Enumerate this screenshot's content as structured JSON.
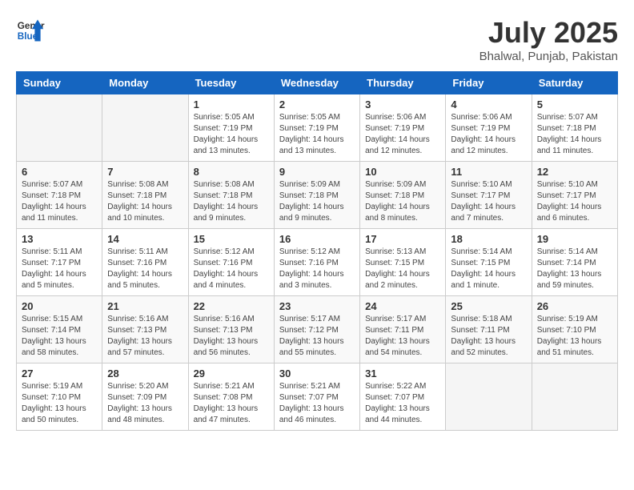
{
  "header": {
    "logo_general": "General",
    "logo_blue": "Blue",
    "month_title": "July 2025",
    "location": "Bhalwal, Punjab, Pakistan"
  },
  "calendar": {
    "days_of_week": [
      "Sunday",
      "Monday",
      "Tuesday",
      "Wednesday",
      "Thursday",
      "Friday",
      "Saturday"
    ],
    "weeks": [
      [
        {
          "day": "",
          "info": ""
        },
        {
          "day": "",
          "info": ""
        },
        {
          "day": "1",
          "info": "Sunrise: 5:05 AM\nSunset: 7:19 PM\nDaylight: 14 hours\nand 13 minutes."
        },
        {
          "day": "2",
          "info": "Sunrise: 5:05 AM\nSunset: 7:19 PM\nDaylight: 14 hours\nand 13 minutes."
        },
        {
          "day": "3",
          "info": "Sunrise: 5:06 AM\nSunset: 7:19 PM\nDaylight: 14 hours\nand 12 minutes."
        },
        {
          "day": "4",
          "info": "Sunrise: 5:06 AM\nSunset: 7:19 PM\nDaylight: 14 hours\nand 12 minutes."
        },
        {
          "day": "5",
          "info": "Sunrise: 5:07 AM\nSunset: 7:18 PM\nDaylight: 14 hours\nand 11 minutes."
        }
      ],
      [
        {
          "day": "6",
          "info": "Sunrise: 5:07 AM\nSunset: 7:18 PM\nDaylight: 14 hours\nand 11 minutes."
        },
        {
          "day": "7",
          "info": "Sunrise: 5:08 AM\nSunset: 7:18 PM\nDaylight: 14 hours\nand 10 minutes."
        },
        {
          "day": "8",
          "info": "Sunrise: 5:08 AM\nSunset: 7:18 PM\nDaylight: 14 hours\nand 9 minutes."
        },
        {
          "day": "9",
          "info": "Sunrise: 5:09 AM\nSunset: 7:18 PM\nDaylight: 14 hours\nand 9 minutes."
        },
        {
          "day": "10",
          "info": "Sunrise: 5:09 AM\nSunset: 7:18 PM\nDaylight: 14 hours\nand 8 minutes."
        },
        {
          "day": "11",
          "info": "Sunrise: 5:10 AM\nSunset: 7:17 PM\nDaylight: 14 hours\nand 7 minutes."
        },
        {
          "day": "12",
          "info": "Sunrise: 5:10 AM\nSunset: 7:17 PM\nDaylight: 14 hours\nand 6 minutes."
        }
      ],
      [
        {
          "day": "13",
          "info": "Sunrise: 5:11 AM\nSunset: 7:17 PM\nDaylight: 14 hours\nand 5 minutes."
        },
        {
          "day": "14",
          "info": "Sunrise: 5:11 AM\nSunset: 7:16 PM\nDaylight: 14 hours\nand 5 minutes."
        },
        {
          "day": "15",
          "info": "Sunrise: 5:12 AM\nSunset: 7:16 PM\nDaylight: 14 hours\nand 4 minutes."
        },
        {
          "day": "16",
          "info": "Sunrise: 5:12 AM\nSunset: 7:16 PM\nDaylight: 14 hours\nand 3 minutes."
        },
        {
          "day": "17",
          "info": "Sunrise: 5:13 AM\nSunset: 7:15 PM\nDaylight: 14 hours\nand 2 minutes."
        },
        {
          "day": "18",
          "info": "Sunrise: 5:14 AM\nSunset: 7:15 PM\nDaylight: 14 hours\nand 1 minute."
        },
        {
          "day": "19",
          "info": "Sunrise: 5:14 AM\nSunset: 7:14 PM\nDaylight: 13 hours\nand 59 minutes."
        }
      ],
      [
        {
          "day": "20",
          "info": "Sunrise: 5:15 AM\nSunset: 7:14 PM\nDaylight: 13 hours\nand 58 minutes."
        },
        {
          "day": "21",
          "info": "Sunrise: 5:16 AM\nSunset: 7:13 PM\nDaylight: 13 hours\nand 57 minutes."
        },
        {
          "day": "22",
          "info": "Sunrise: 5:16 AM\nSunset: 7:13 PM\nDaylight: 13 hours\nand 56 minutes."
        },
        {
          "day": "23",
          "info": "Sunrise: 5:17 AM\nSunset: 7:12 PM\nDaylight: 13 hours\nand 55 minutes."
        },
        {
          "day": "24",
          "info": "Sunrise: 5:17 AM\nSunset: 7:11 PM\nDaylight: 13 hours\nand 54 minutes."
        },
        {
          "day": "25",
          "info": "Sunrise: 5:18 AM\nSunset: 7:11 PM\nDaylight: 13 hours\nand 52 minutes."
        },
        {
          "day": "26",
          "info": "Sunrise: 5:19 AM\nSunset: 7:10 PM\nDaylight: 13 hours\nand 51 minutes."
        }
      ],
      [
        {
          "day": "27",
          "info": "Sunrise: 5:19 AM\nSunset: 7:10 PM\nDaylight: 13 hours\nand 50 minutes."
        },
        {
          "day": "28",
          "info": "Sunrise: 5:20 AM\nSunset: 7:09 PM\nDaylight: 13 hours\nand 48 minutes."
        },
        {
          "day": "29",
          "info": "Sunrise: 5:21 AM\nSunset: 7:08 PM\nDaylight: 13 hours\nand 47 minutes."
        },
        {
          "day": "30",
          "info": "Sunrise: 5:21 AM\nSunset: 7:07 PM\nDaylight: 13 hours\nand 46 minutes."
        },
        {
          "day": "31",
          "info": "Sunrise: 5:22 AM\nSunset: 7:07 PM\nDaylight: 13 hours\nand 44 minutes."
        },
        {
          "day": "",
          "info": ""
        },
        {
          "day": "",
          "info": ""
        }
      ]
    ]
  }
}
